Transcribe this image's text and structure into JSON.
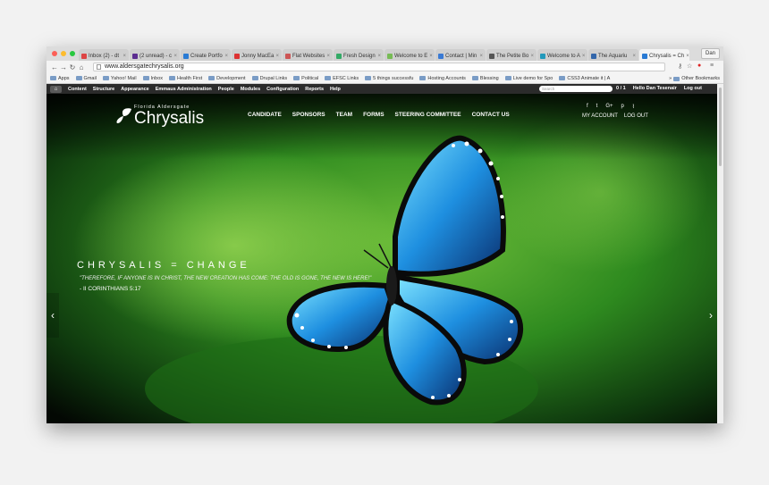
{
  "browser": {
    "tabs": [
      {
        "label": "Inbox (2) - dt",
        "color": "#d44"
      },
      {
        "label": "(2 unread) - c",
        "color": "#5b2d90"
      },
      {
        "label": "Create Portfo",
        "color": "#2a7bd4"
      },
      {
        "label": "Jonny MacEa",
        "color": "#d33"
      },
      {
        "label": "Flat Websites",
        "color": "#c55"
      },
      {
        "label": "Fresh Design",
        "color": "#3a6"
      },
      {
        "label": "Welcome to E",
        "color": "#7b5"
      },
      {
        "label": "Contact | Min",
        "color": "#3a7ad4"
      },
      {
        "label": "The Petite Bo",
        "color": "#555"
      },
      {
        "label": "Welcome to A",
        "color": "#29b"
      },
      {
        "label": "The Aquariu",
        "color": "#36a"
      },
      {
        "label": "Chrysalis = Ch",
        "color": "#2a7bd4",
        "active": true
      }
    ],
    "profile": "Dan",
    "url": "www.aldersgatechrysalis.org",
    "bookmarks": [
      "Apps",
      "Gmail",
      "Yahoo! Mail",
      "Inbox",
      "Health First",
      "Development",
      "Drupal Links",
      "Political",
      "EFSC Links",
      "5 things successfu",
      "Hosting Accounts",
      "Blessing",
      "Live demo for Spo",
      "CSS3 Animate it | A"
    ],
    "bookmarks_more": "»",
    "other_bookmarks": "Other Bookmarks"
  },
  "admin": {
    "menu": [
      "Content",
      "Structure",
      "Appearance",
      "Emmaus Administration",
      "People",
      "Modules",
      "Configuration",
      "Reports",
      "Help"
    ],
    "search_placeholder": "Search",
    "counter": "0 / 1",
    "greeting": "Hello Dan Tesenair",
    "logout": "Log out"
  },
  "site": {
    "logo_sub": "Florida Aldersgate",
    "logo_main": "Chrysalis",
    "nav": [
      "CANDIDATE",
      "SPONSORS",
      "TEAM",
      "FORMS",
      "STEERING COMMITTEE",
      "CONTACT US"
    ],
    "social": [
      "f",
      "t",
      "G+",
      "p",
      "rss"
    ],
    "my_account": "MY ACCOUNT",
    "log_out": "LOG OUT"
  },
  "slide": {
    "title": "CHRYSALIS = CHANGE",
    "quote": "\"THEREFORE, IF ANYONE IS IN CHRIST, THE NEW CREATION HAS COME: THE OLD IS GONE, THE NEW IS HERE!\"",
    "reference": "- II CORINTHIANS 5:17",
    "prev": "‹",
    "next": "›"
  }
}
